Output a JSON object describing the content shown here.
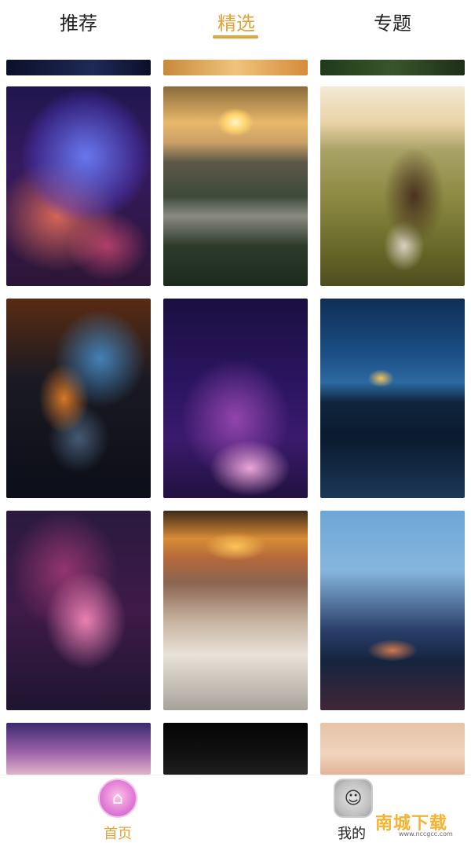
{
  "tabs": [
    {
      "label": "推荐",
      "active": false
    },
    {
      "label": "精选",
      "active": true
    },
    {
      "label": "专题",
      "active": false
    }
  ],
  "accent_color": "#e2a33a",
  "gallery": {
    "thumbnails": [
      {
        "name": "thumb-strip-1"
      },
      {
        "name": "thumb-strip-2"
      },
      {
        "name": "thumb-strip-3"
      },
      {
        "name": "nebula-purple"
      },
      {
        "name": "sunrise-valley"
      },
      {
        "name": "girl-field"
      },
      {
        "name": "nebula-blue-orange"
      },
      {
        "name": "galaxy-purple"
      },
      {
        "name": "castle-island-dusk"
      },
      {
        "name": "orion-nebula"
      },
      {
        "name": "sunset-waves"
      },
      {
        "name": "city-skyline"
      },
      {
        "name": "basilica-dusk"
      },
      {
        "name": "dark-plant"
      },
      {
        "name": "pink-flower"
      }
    ]
  },
  "bottom_nav": {
    "home": {
      "label": "首页",
      "icon": "home-icon"
    },
    "mine": {
      "label": "我的",
      "icon": "profile-icon"
    }
  },
  "watermark": {
    "text": "南城下载",
    "url": "www.nccgcc.com"
  }
}
